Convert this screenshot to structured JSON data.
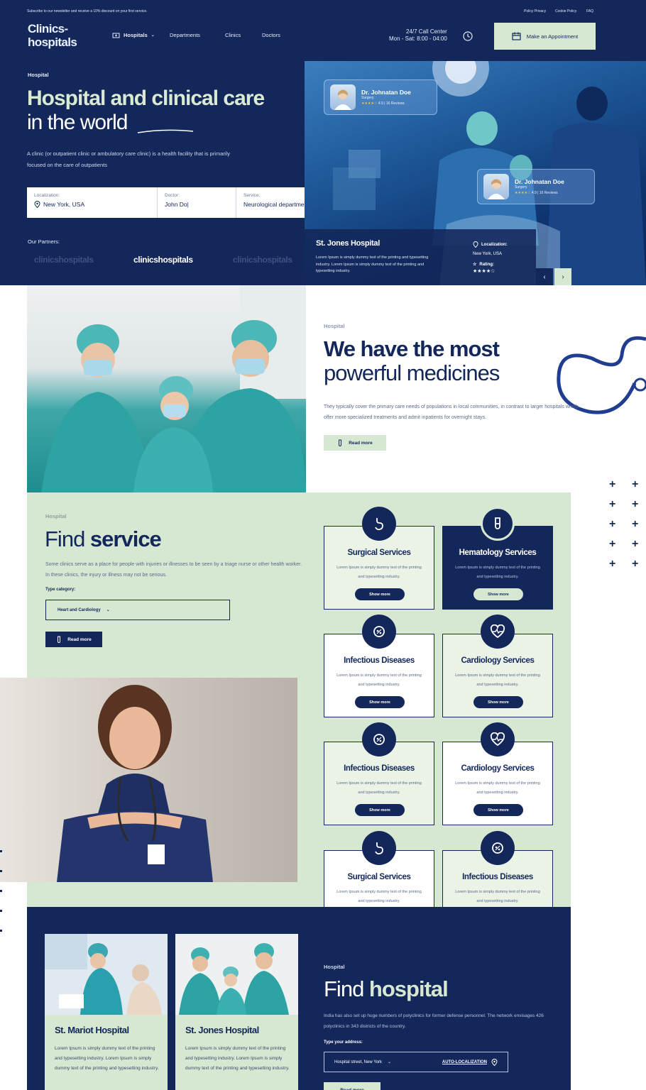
{
  "topbar": {
    "newsletter": "Subscribe to our newsletter and receive a 10% discount on your first service.",
    "links": [
      "Policy Privacy",
      "Cookie Policy",
      "FAQ"
    ]
  },
  "header": {
    "logo_line1": "Clinics-",
    "logo_line2": "hospitals",
    "nav": [
      "Hospitals",
      "Departments",
      "Clinics",
      "Doctors"
    ],
    "call_title": "24/7 Call Center",
    "call_hours": "Mon - Sat: 8:00 - 04:00",
    "appointment_label": "Make an Appointment"
  },
  "hero": {
    "eyebrow": "Hospital",
    "title_bold": "Hospital and clinical care",
    "title_thin": " in the world",
    "desc": "A clinic (or outpatient clinic or ambulatory care clinic) is a health facility that is primarily focused on the care of outpatients",
    "search": {
      "loc_label": "Localization:",
      "loc_value": "New York, USA",
      "doc_label": "Doctor:",
      "doc_value": "John Do|",
      "svc_label": "Service:",
      "svc_value": "Neurological department"
    },
    "partners_label": "Our Partners:",
    "partners": [
      "clinicshospitals",
      "clinicshospitals",
      "clinicshospitals"
    ]
  },
  "doctor_cards": [
    {
      "name": "Dr. Johnatan Doe",
      "spec": "Surgery",
      "rating": "4.9 | 16 Reviews"
    },
    {
      "name": "Dr. Johnatan Doe",
      "spec": "Surgery",
      "rating": "4.9 | 16 Reviews"
    }
  ],
  "featured_hospital": {
    "name": "St. Jones Hospital",
    "desc": "Lorem Ipsum is simply dummy text of the printing and typesetting industry. Lorem Ipsum is simply dummy text of the printing and typesetting industry.",
    "loc_label": "Localization:",
    "loc_value": "New York, USA",
    "rating_label": "Rating:"
  },
  "medicines": {
    "eyebrow": "Hospital",
    "title_bold": "We have the most",
    "title_thin": "powerful medicines",
    "desc": "They typically cover the primary care needs of populations in local communities, in contrast to larger hospitals which offer more specialized treatments and admit inpatients for overnight stays.",
    "read_more": "Read more"
  },
  "services": {
    "eyebrow": "Hospital",
    "title_thin": "Find ",
    "title_bold": "service",
    "desc": "Some clinics serve as a place for people with injuries or illnesses to be seen by a triage nurse or other health worker. In these clinics, the injury or illness may not be serious.",
    "type_label": "Type category:",
    "type_value": "Heart and Cardiology",
    "read_more": "Read more",
    "card_desc": "Lorem Ipsum is simply dummy text of the printing and typesetting industry.",
    "show_more": "Show more",
    "cards": [
      {
        "name": "Surgical Services",
        "icon": "stomach-icon"
      },
      {
        "name": "Hematology Services",
        "icon": "test-tube-icon"
      },
      {
        "name": "Infectious Diseases",
        "icon": "virus-icon"
      },
      {
        "name": "Cardiology Services",
        "icon": "heart-pulse-icon"
      },
      {
        "name": "Infectious Diseases",
        "icon": "virus-icon"
      },
      {
        "name": "Cardiology Services",
        "icon": "heart-pulse-icon"
      },
      {
        "name": "Surgical Services",
        "icon": "stomach-icon"
      },
      {
        "name": "Infectious Diseases",
        "icon": "virus-icon"
      }
    ]
  },
  "hospitals": {
    "cards": [
      {
        "name": "St. Mariot Hospital",
        "desc": "Lorem Ipsum is simply dummy text of the printing and typesetting industry. Lorem Ipsum is simply dummy text of the printing and typesetting industry."
      },
      {
        "name": "St. Jones Hospital",
        "desc": "Lorem Ipsum is simply dummy text of the printing and typesetting industry. Lorem Ipsum is simply dummy text of the printing and typesetting industry."
      }
    ],
    "eyebrow": "Hospital",
    "title_thin": "Find ",
    "title_bold": "hospital",
    "desc": "India has also set up huge numbers of polyclinics for former defense personnel. The network envisages 426 polyclinics in 343 districts of the country.",
    "addr_label": "Type your address:",
    "addr_value": "Hospital street, New York",
    "auto_loc": "AUTO-LOCALIZATION",
    "read_more": "Read more"
  },
  "colors": {
    "navy": "#13275a",
    "mint": "#d6e8d1",
    "white": "#ffffff"
  }
}
